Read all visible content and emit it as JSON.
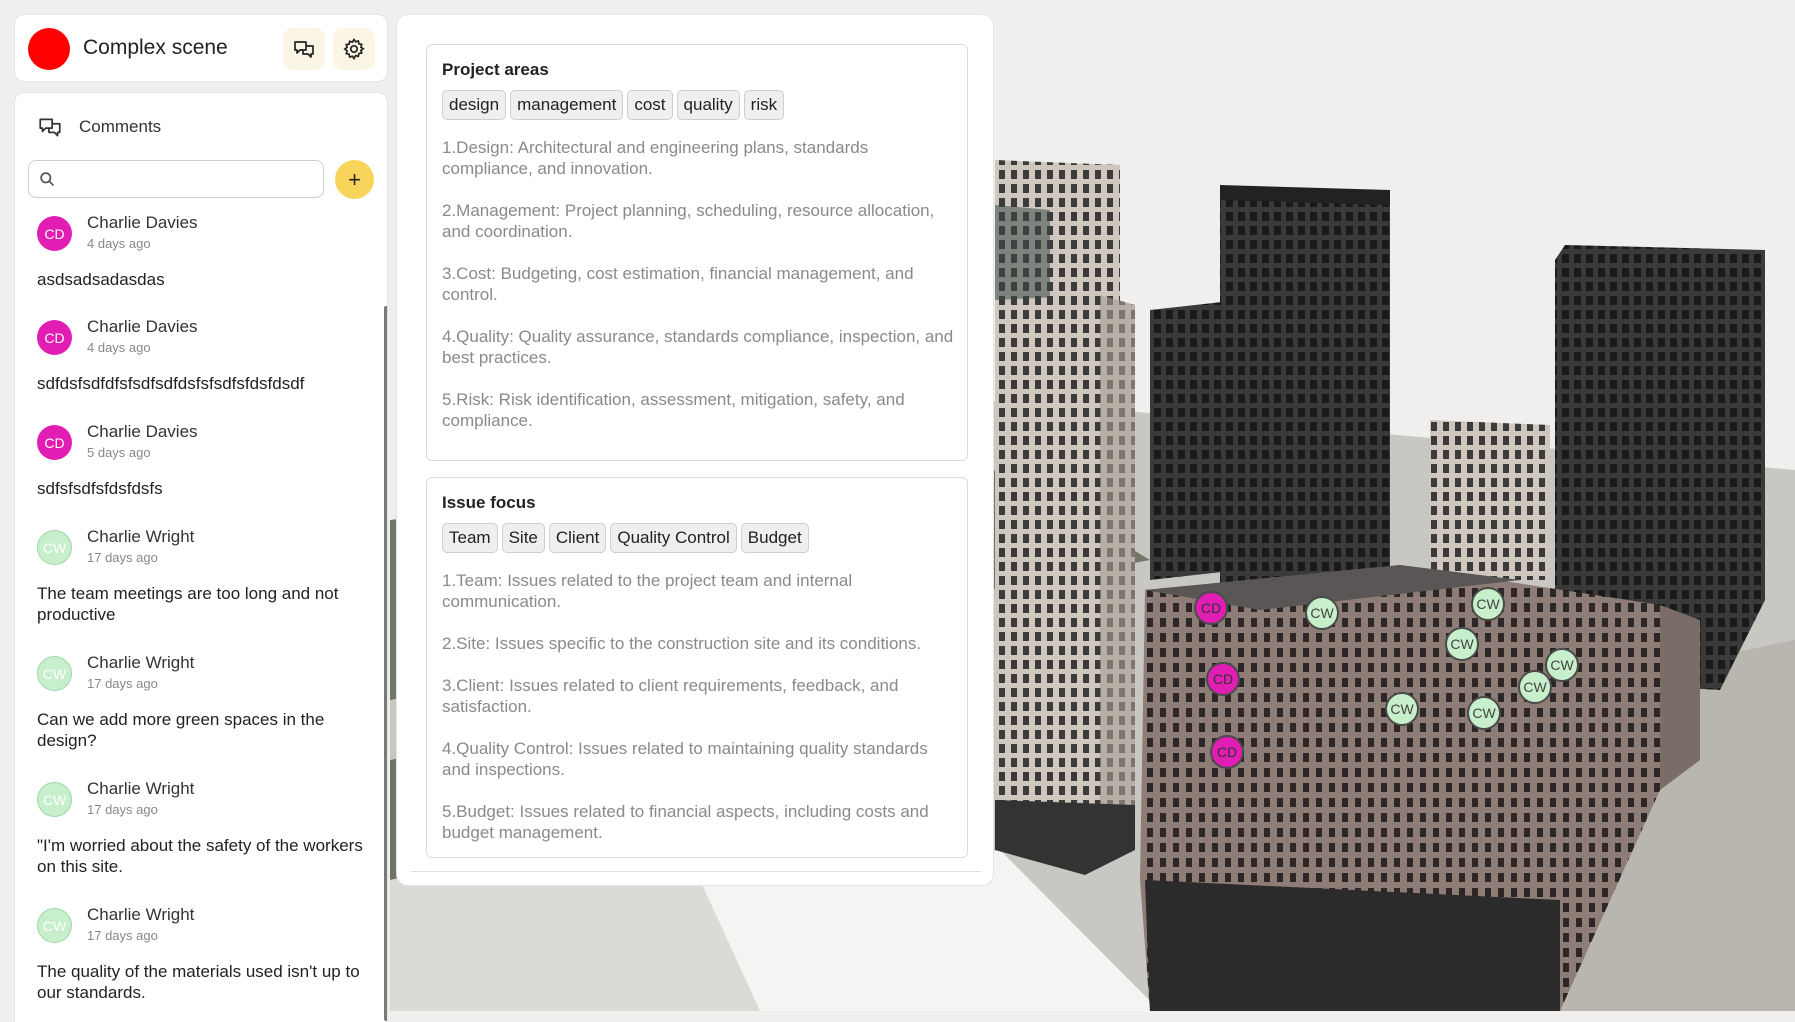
{
  "app": {
    "title": "Complex scene"
  },
  "comments": {
    "heading": "Comments",
    "search_placeholder": "",
    "add_label": "+",
    "items": [
      {
        "initials": "CD",
        "author": "Charlie Davies",
        "time": "4 days ago",
        "text": "asdsadsadasdas"
      },
      {
        "initials": "CD",
        "author": "Charlie Davies",
        "time": "4 days ago",
        "text": "sdfdsfsdfdfsfsdfsdfdsfsfsdfsfdsfdsdf"
      },
      {
        "initials": "CD",
        "author": "Charlie Davies",
        "time": "5 days ago",
        "text": "sdfsfsdfsfdsfdsfs"
      },
      {
        "initials": "CW",
        "author": "Charlie Wright",
        "time": "17 days ago",
        "text": "The team meetings are too long and not productive"
      },
      {
        "initials": "CW",
        "author": "Charlie Wright",
        "time": "17 days ago",
        "text": "Can we add more green spaces in the design?"
      },
      {
        "initials": "CW",
        "author": "Charlie Wright",
        "time": "17 days ago",
        "text": "\"I'm worried about the safety of the workers on this site."
      },
      {
        "initials": "CW",
        "author": "Charlie Wright",
        "time": "17 days ago",
        "text": "The quality of the materials used isn't up to our standards."
      }
    ]
  },
  "project_areas": {
    "title": "Project areas",
    "tags": [
      "design",
      "management",
      "cost",
      "quality",
      "risk"
    ],
    "descriptions": [
      "1.Design: Architectural and engineering plans, standards compliance, and innovation.",
      "2.Management: Project planning, scheduling, resource allocation, and coordination.",
      "3.Cost: Budgeting, cost estimation, financial management, and control.",
      "4.Quality: Quality assurance, standards compliance, inspection, and best practices.",
      "5.Risk: Risk identification, assessment, mitigation, safety, and compliance."
    ]
  },
  "issue_focus": {
    "title": "Issue focus",
    "tags": [
      "Team",
      "Site",
      "Client",
      "Quality Control",
      "Budget"
    ],
    "descriptions": [
      "1.Team: Issues related to the project team and internal communication.",
      "2.Site: Issues specific to the construction site and its conditions.",
      "3.Client: Issues related to client requirements, feedback, and satisfaction.",
      "4.Quality Control: Issues related to maintaining quality standards and inspections.",
      "5.Budget: Issues related to financial aspects, including costs and budget management."
    ]
  },
  "markers": [
    "CD",
    "CW",
    "CW",
    "CW",
    "CD",
    "CW",
    "CW",
    "CW",
    "CW",
    "CD"
  ],
  "colors": {
    "brand": "#ff0000",
    "accent": "#f8d55a",
    "cd_avatar": "#e21db3",
    "cw_avatar": "#c7efcc"
  },
  "icons": {
    "chat": "chat-bubbles-icon",
    "settings": "gear-icon",
    "search": "search-icon"
  }
}
